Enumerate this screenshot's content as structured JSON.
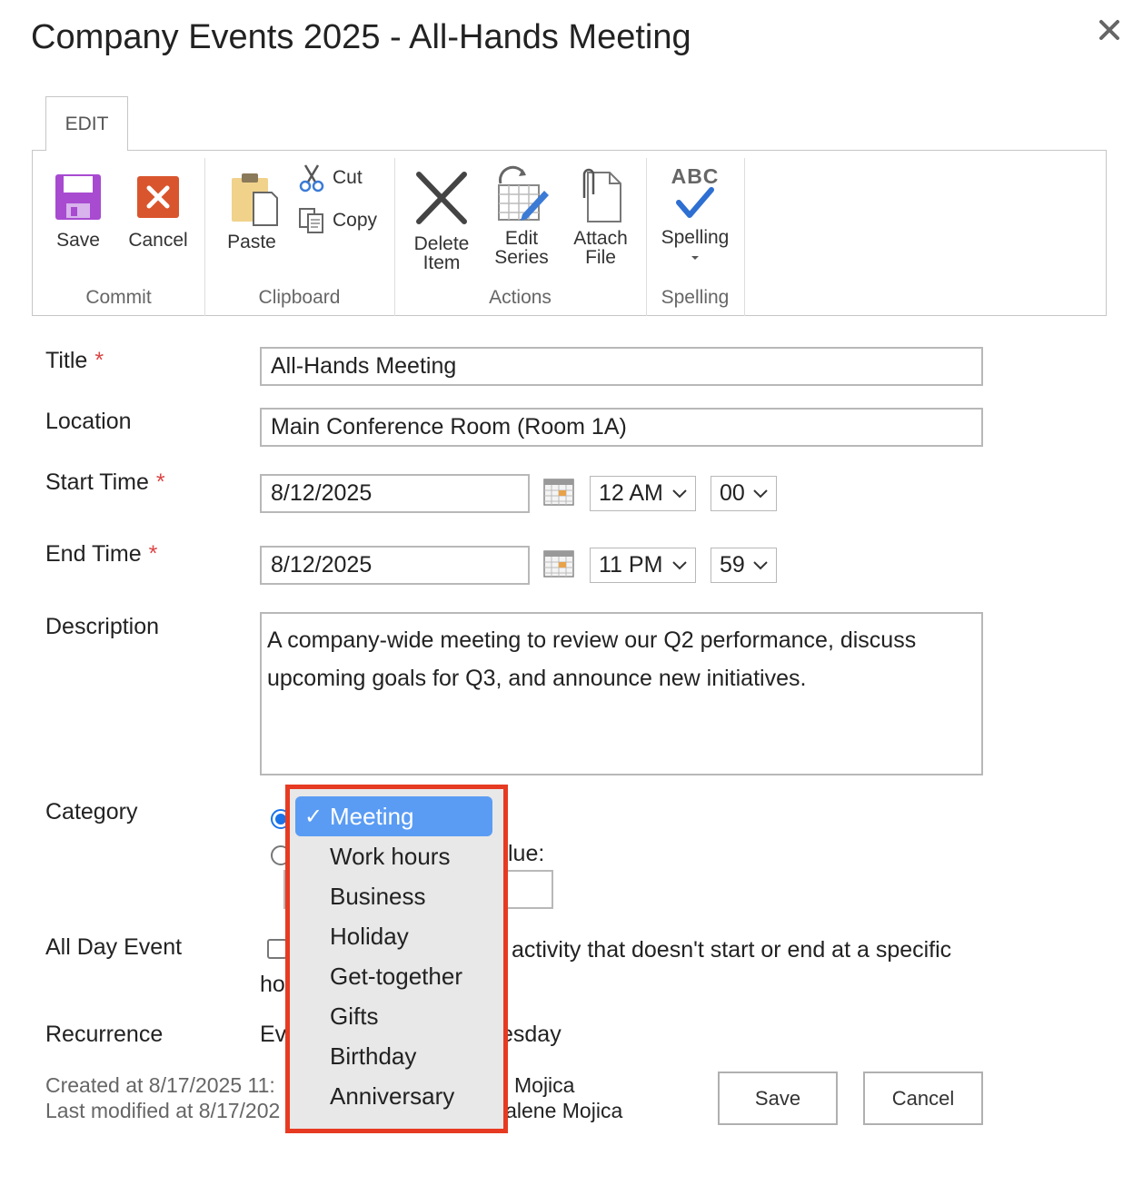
{
  "dialog": {
    "title": "Company Events 2025 - All-Hands Meeting"
  },
  "ribbon": {
    "tab": "EDIT",
    "groups": {
      "commit": "Commit",
      "clipboard": "Clipboard",
      "actions": "Actions",
      "spelling": "Spelling"
    },
    "buttons": {
      "save": "Save",
      "cancel": "Cancel",
      "paste": "Paste",
      "cut": "Cut",
      "copy": "Copy",
      "delete_l1": "Delete",
      "delete_l2": "Item",
      "edit_l1": "Edit",
      "edit_l2": "Series",
      "attach_l1": "Attach",
      "attach_l2": "File",
      "spelling": "Spelling",
      "abc": "ABC"
    }
  },
  "form": {
    "title": {
      "label": "Title",
      "value": "All-Hands Meeting"
    },
    "location": {
      "label": "Location",
      "value": "Main Conference Room (Room 1A)"
    },
    "start": {
      "label": "Start Time",
      "date": "8/12/2025",
      "hour": "12 AM",
      "minute": "00"
    },
    "end": {
      "label": "End Time",
      "date": "8/12/2025",
      "hour": "11 PM",
      "minute": "59"
    },
    "description": {
      "label": "Description",
      "value": "A company-wide meeting to review our Q2 performance, discuss upcoming goals for Q3, and announce new initiatives."
    },
    "category": {
      "label": "Category",
      "custom_partial": "lue:"
    },
    "all_day": {
      "label": "All Day Event",
      "text_line1": "activity that doesn't start or end at a specific",
      "text_line2": "ho"
    },
    "recurrence": {
      "label": "Recurrence",
      "text_left": "Ev",
      "text_right": "esday"
    },
    "required_mark": "*"
  },
  "footer": {
    "created": "Created at 8/17/2025 11:",
    "created_by": "Mojica",
    "modified": "Last modified at 8/17/202",
    "modified_by": "lalene Mojica",
    "save": "Save",
    "cancel": "Cancel"
  },
  "dropdown": {
    "check": "✓",
    "items": [
      "Meeting",
      "Work hours",
      "Business",
      "Holiday",
      "Get-together",
      "Gifts",
      "Birthday",
      "Anniversary"
    ],
    "selected_index": 0
  },
  "colors": {
    "accent": "#5a9cf4",
    "highlight": "#e73a22",
    "save_icon": "#a84bd1",
    "cancel_icon": "#d9552e"
  }
}
